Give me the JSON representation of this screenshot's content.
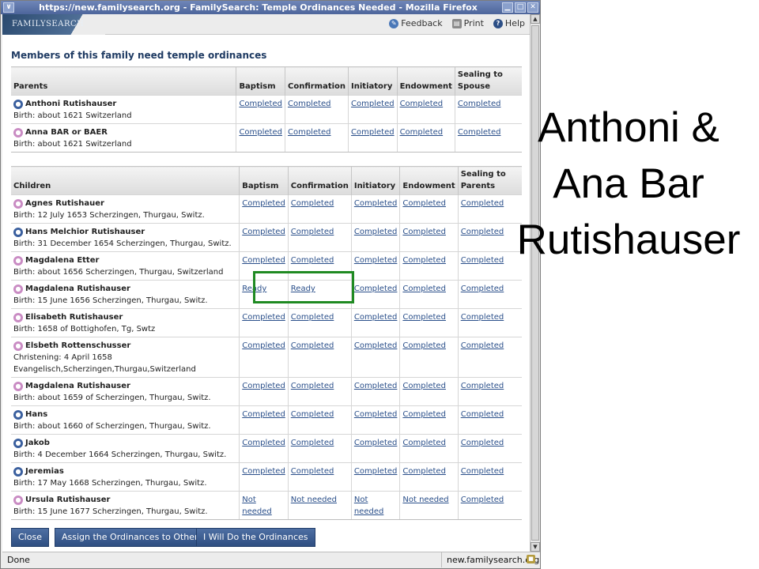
{
  "window": {
    "title": "https://new.familysearch.org - FamilySearch: Temple Ordinances Needed - Mozilla Firefox",
    "menu_glyph": "∨",
    "btn_min": "▁",
    "btn_max": "□",
    "btn_close": "✕"
  },
  "header": {
    "logo": "FAMILYSEARCH",
    "links": {
      "feedback": "Feedback",
      "print": "Print",
      "help": "Help"
    }
  },
  "page": {
    "heading": "Members of this family need temple ordinances"
  },
  "parents": {
    "headers": [
      "Parents",
      "Baptism",
      "Confirmation",
      "Initiatory",
      "Endowment",
      "Sealing to Spouse"
    ],
    "rows": [
      {
        "gender": "male",
        "name": "Anthoni Rutishauser",
        "detail1": "Birth: about 1621 Switzerland",
        "detail2": "",
        "ordinances": [
          "Completed",
          "Completed",
          "Completed",
          "Completed",
          "Completed"
        ]
      },
      {
        "gender": "female",
        "name": "Anna BAR or BAER",
        "detail1": "Birth: about 1621 Switzerland",
        "detail2": "",
        "ordinances": [
          "Completed",
          "Completed",
          "Completed",
          "Completed",
          "Completed"
        ]
      }
    ]
  },
  "children": {
    "headers": [
      "Children",
      "Baptism",
      "Confirmation",
      "Initiatory",
      "Endowment",
      "Sealing to Parents"
    ],
    "rows": [
      {
        "gender": "female",
        "name": "Agnes Rutishauer",
        "detail1": "Birth: 12 July 1653 Scherzingen, Thurgau, Switz.",
        "detail2": "",
        "ordinances": [
          "Completed",
          "Completed",
          "Completed",
          "Completed",
          "Completed"
        ]
      },
      {
        "gender": "male",
        "name": "Hans Melchior Rutishauser",
        "detail1": "Birth: 31 December 1654 Scherzingen, Thurgau, Switz.",
        "detail2": "",
        "ordinances": [
          "Completed",
          "Completed",
          "Completed",
          "Completed",
          "Completed"
        ]
      },
      {
        "gender": "female",
        "name": "Magdalena Etter",
        "detail1": "Birth: about 1656 Scherzingen, Thurgau, Switzerland",
        "detail2": "",
        "ordinances": [
          "Completed",
          "Completed",
          "Completed",
          "Completed",
          "Completed"
        ]
      },
      {
        "gender": "female",
        "name": "Magdalena Rutishauser",
        "detail1": "Birth: 15 June 1656 Scherzingen, Thurgau, Switz.",
        "detail2": "",
        "ordinances": [
          "Ready",
          "Ready",
          "Completed",
          "Completed",
          "Completed"
        ]
      },
      {
        "gender": "female",
        "name": "Elisabeth Rutishauser",
        "detail1": "Birth: 1658 of Bottighofen, Tg, Swtz",
        "detail2": "",
        "ordinances": [
          "Completed",
          "Completed",
          "Completed",
          "Completed",
          "Completed"
        ]
      },
      {
        "gender": "female",
        "name": "Elsbeth Rottenschusser",
        "detail1": "Christening: 4 April 1658",
        "detail2": "Evangelisch,Scherzingen,Thurgau,Switzerland",
        "ordinances": [
          "Completed",
          "Completed",
          "Completed",
          "Completed",
          "Completed"
        ]
      },
      {
        "gender": "female",
        "name": "Magdalena Rutishauser",
        "detail1": "Birth: about 1659 of Scherzingen, Thurgau, Switz.",
        "detail2": "",
        "ordinances": [
          "Completed",
          "Completed",
          "Completed",
          "Completed",
          "Completed"
        ]
      },
      {
        "gender": "male",
        "name": "Hans",
        "detail1": "Birth: about 1660 of Scherzingen, Thurgau, Switz.",
        "detail2": "",
        "ordinances": [
          "Completed",
          "Completed",
          "Completed",
          "Completed",
          "Completed"
        ]
      },
      {
        "gender": "male",
        "name": "Jakob",
        "detail1": "Birth: 4 December 1664 Scherzingen, Thurgau, Switz.",
        "detail2": "",
        "ordinances": [
          "Completed",
          "Completed",
          "Completed",
          "Completed",
          "Completed"
        ]
      },
      {
        "gender": "male",
        "name": "Jeremias",
        "detail1": "Birth: 17 May 1668 Scherzingen, Thurgau, Switz.",
        "detail2": "",
        "ordinances": [
          "Completed",
          "Completed",
          "Completed",
          "Completed",
          "Completed"
        ]
      },
      {
        "gender": "female",
        "name": "Ursula Rutishauser",
        "detail1": "Birth: 15 June 1677 Scherzingen, Thurgau, Switz.",
        "detail2": "",
        "ordinances": [
          "Not needed",
          "Not needed",
          "Not needed",
          "Not needed",
          "Completed"
        ]
      }
    ]
  },
  "footer": {
    "close": "Close",
    "assign": "Assign the Ordinances to Others",
    "will_do": "I Will Do the Ordinances"
  },
  "statusbar": {
    "text": "Done",
    "url": "new.familysearch.org"
  },
  "caption": {
    "line1": "Anthoni &",
    "line2": "Ana Bar",
    "line3": "Rutishauser"
  },
  "colors": {
    "highlight": "#1f8a22",
    "link": "#2a4f8a",
    "male": "#3a5f9e",
    "female": "#c98bc3"
  },
  "icons": {
    "male": "male-person-icon",
    "female": "female-person-icon"
  }
}
